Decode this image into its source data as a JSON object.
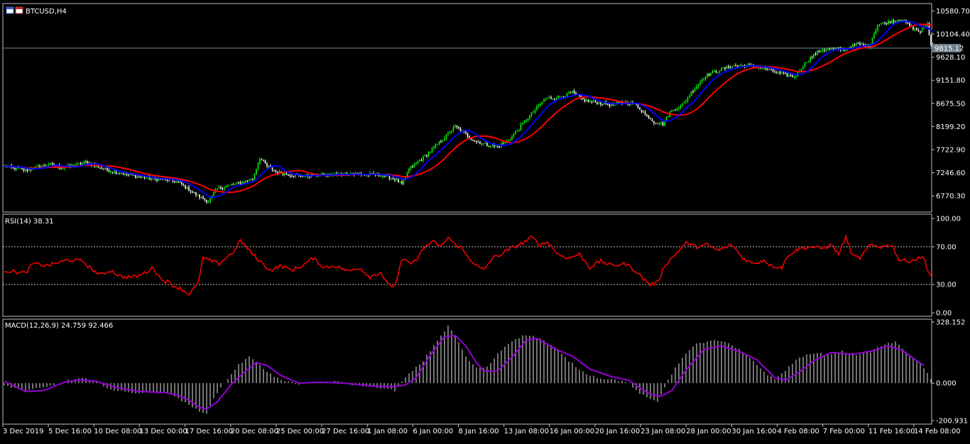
{
  "window": {
    "symbol_label": "BTCUSD,H4",
    "icon": "window-icon"
  },
  "colors": {
    "background": "#000000",
    "frame": "#c0c0c0",
    "grid": "#c0c0c0",
    "bull_candle": "#00ff00",
    "bear_candle": "#ffffff",
    "ma_fast": "#0000ff",
    "ma_slow": "#ff0000",
    "rsi": "#ff0000",
    "macd_hist": "#c0c0c0",
    "macd_signal": "#9400d3",
    "price_line": "#778899",
    "price_tag": "#708090"
  },
  "chart_data": [
    {
      "type": "candlestick",
      "panel": "price",
      "title": "BTCUSD,H4",
      "ylim": [
        6450,
        10720
      ],
      "yticks": [
        "10580.70",
        "10104.40",
        "9628.10",
        "9151.80",
        "8675.50",
        "8199.20",
        "7722.90",
        "7246.60",
        "6770.30"
      ],
      "current_price": "9815.12",
      "bar_count": 400,
      "x_tick_labels": [
        "3 Dec 2019",
        "5 Dec 16:00",
        "10 Dec 08:00",
        "13 Dec 00:00",
        "17 Dec 16:00",
        "20 Dec 08:00",
        "25 Dec 00:00",
        "27 Dec 16:00",
        "1 Jan 08:00",
        "6 Jan 00:00",
        "8 Jan 16:00",
        "13 Jan 08:00",
        "16 Jan 00:00",
        "20 Jan 16:00",
        "23 Jan 08:00",
        "28 Jan 00:00",
        "30 Jan 16:00",
        "4 Feb 08:00",
        "7 Feb 00:00",
        "11 Feb 16:00",
        "14 Feb 08:00"
      ],
      "close_path": [
        [
          0,
          7380
        ],
        [
          12,
          7300
        ],
        [
          25,
          7420
        ],
        [
          33,
          7350
        ],
        [
          38,
          7380
        ],
        [
          46,
          7460
        ],
        [
          58,
          7300
        ],
        [
          68,
          7220
        ],
        [
          76,
          7160
        ],
        [
          84,
          7120
        ],
        [
          92,
          7100
        ],
        [
          98,
          7050
        ],
        [
          104,
          6900
        ],
        [
          110,
          6750
        ],
        [
          115,
          6650
        ],
        [
          120,
          6920
        ],
        [
          131,
          7020
        ],
        [
          140,
          7120
        ],
        [
          144,
          7550
        ],
        [
          148,
          7380
        ],
        [
          154,
          7250
        ],
        [
          166,
          7180
        ],
        [
          180,
          7200
        ],
        [
          195,
          7220
        ],
        [
          212,
          7200
        ],
        [
          220,
          7120
        ],
        [
          224,
          7000
        ],
        [
          228,
          7320
        ],
        [
          238,
          7620
        ],
        [
          246,
          7900
        ],
        [
          254,
          8200
        ],
        [
          260,
          8050
        ],
        [
          265,
          7900
        ],
        [
          272,
          7820
        ],
        [
          278,
          7780
        ],
        [
          285,
          7950
        ],
        [
          292,
          8250
        ],
        [
          298,
          8500
        ],
        [
          305,
          8780
        ],
        [
          312,
          8800
        ],
        [
          320,
          8900
        ],
        [
          326,
          8750
        ],
        [
          332,
          8700
        ],
        [
          342,
          8650
        ],
        [
          350,
          8700
        ],
        [
          356,
          8650
        ],
        [
          361,
          8450
        ],
        [
          366,
          8300
        ],
        [
          371,
          8250
        ],
        [
          375,
          8500
        ],
        [
          382,
          8650
        ],
        [
          388,
          8950
        ],
        [
          395,
          9250
        ],
        [
          402,
          9350
        ],
        [
          410,
          9450
        ],
        [
          420,
          9450
        ],
        [
          428,
          9400
        ],
        [
          438,
          9280
        ],
        [
          445,
          9220
        ],
        [
          452,
          9550
        ],
        [
          460,
          9780
        ],
        [
          468,
          9800
        ],
        [
          473,
          9780
        ],
        [
          480,
          9900
        ],
        [
          487,
          9850
        ],
        [
          492,
          10300
        ],
        [
          498,
          10350
        ],
        [
          505,
          10420
        ],
        [
          511,
          10250
        ],
        [
          516,
          10150
        ],
        [
          520,
          10320
        ],
        [
          522,
          9880
        ],
        [
          523,
          9815
        ]
      ]
    },
    {
      "type": "line",
      "panel": "rsi",
      "label": "RSI(14) 38.31",
      "ylim": [
        0,
        100
      ],
      "yticks": [
        "100.00",
        "70.00",
        "30.00",
        "0.00"
      ],
      "levels": [
        70,
        30
      ],
      "values": [
        [
          0,
          45
        ],
        [
          12,
          42
        ],
        [
          16,
          52
        ],
        [
          24,
          50
        ],
        [
          36,
          56
        ],
        [
          44,
          55
        ],
        [
          48,
          48
        ],
        [
          54,
          40
        ],
        [
          60,
          45
        ],
        [
          66,
          38
        ],
        [
          74,
          38
        ],
        [
          80,
          43
        ],
        [
          84,
          48
        ],
        [
          88,
          36
        ],
        [
          92,
          33
        ],
        [
          96,
          28
        ],
        [
          100,
          25
        ],
        [
          104,
          20
        ],
        [
          109,
          30
        ],
        [
          112,
          58
        ],
        [
          121,
          52
        ],
        [
          126,
          60
        ],
        [
          130,
          66
        ],
        [
          133,
          77
        ],
        [
          137,
          68
        ],
        [
          142,
          58
        ],
        [
          150,
          45
        ],
        [
          156,
          50
        ],
        [
          162,
          45
        ],
        [
          168,
          50
        ],
        [
          174,
          58
        ],
        [
          180,
          48
        ],
        [
          186,
          50
        ],
        [
          194,
          44
        ],
        [
          200,
          48
        ],
        [
          206,
          38
        ],
        [
          212,
          43
        ],
        [
          216,
          30
        ],
        [
          220,
          28
        ],
        [
          224,
          56
        ],
        [
          230,
          52
        ],
        [
          238,
          72
        ],
        [
          242,
          75
        ],
        [
          246,
          70
        ],
        [
          250,
          80
        ],
        [
          254,
          72
        ],
        [
          257,
          70
        ],
        [
          260,
          62
        ],
        [
          266,
          50
        ],
        [
          270,
          45
        ],
        [
          275,
          58
        ],
        [
          280,
          62
        ],
        [
          285,
          68
        ],
        [
          292,
          74
        ],
        [
          297,
          80
        ],
        [
          302,
          72
        ],
        [
          306,
          75
        ],
        [
          312,
          62
        ],
        [
          318,
          58
        ],
        [
          324,
          62
        ],
        [
          330,
          48
        ],
        [
          336,
          55
        ],
        [
          342,
          50
        ],
        [
          350,
          52
        ],
        [
          356,
          44
        ],
        [
          360,
          36
        ],
        [
          364,
          30
        ],
        [
          368,
          32
        ],
        [
          372,
          50
        ],
        [
          378,
          62
        ],
        [
          384,
          74
        ],
        [
          390,
          70
        ],
        [
          396,
          72
        ],
        [
          402,
          66
        ],
        [
          410,
          72
        ],
        [
          416,
          58
        ],
        [
          422,
          52
        ],
        [
          428,
          56
        ],
        [
          432,
          50
        ],
        [
          438,
          48
        ],
        [
          442,
          62
        ],
        [
          448,
          68
        ],
        [
          454,
          70
        ],
        [
          460,
          68
        ],
        [
          466,
          72
        ],
        [
          470,
          62
        ],
        [
          474,
          80
        ],
        [
          478,
          60
        ],
        [
          482,
          58
        ],
        [
          488,
          72
        ],
        [
          494,
          70
        ],
        [
          500,
          72
        ],
        [
          504,
          56
        ],
        [
          510,
          55
        ],
        [
          516,
          58
        ],
        [
          518,
          60
        ],
        [
          520,
          45
        ],
        [
          522,
          38.31
        ]
      ]
    },
    {
      "type": "bar+line",
      "panel": "macd",
      "label": "MACD(12,26,9) 24.759 92.466",
      "ylim": [
        -200.931,
        328.152
      ],
      "yticks": [
        "328.152",
        "0.000",
        "-200.931"
      ],
      "histogram": [
        [
          0,
          -12
        ],
        [
          12,
          -40
        ],
        [
          24,
          -22
        ],
        [
          36,
          15
        ],
        [
          44,
          28
        ],
        [
          52,
          5
        ],
        [
          62,
          -40
        ],
        [
          74,
          -52
        ],
        [
          84,
          -48
        ],
        [
          92,
          -50
        ],
        [
          98,
          -80
        ],
        [
          104,
          -120
        ],
        [
          110,
          -150
        ],
        [
          114,
          -160
        ],
        [
          120,
          -50
        ],
        [
          126,
          25
        ],
        [
          132,
          100
        ],
        [
          138,
          140
        ],
        [
          142,
          120
        ],
        [
          148,
          60
        ],
        [
          156,
          15
        ],
        [
          166,
          -5
        ],
        [
          176,
          5
        ],
        [
          186,
          10
        ],
        [
          196,
          -8
        ],
        [
          206,
          -15
        ],
        [
          214,
          -30
        ],
        [
          220,
          -40
        ],
        [
          226,
          30
        ],
        [
          236,
          120
        ],
        [
          244,
          230
        ],
        [
          250,
          305
        ],
        [
          254,
          260
        ],
        [
          260,
          140
        ],
        [
          266,
          80
        ],
        [
          272,
          85
        ],
        [
          278,
          160
        ],
        [
          286,
          230
        ],
        [
          294,
          260
        ],
        [
          302,
          240
        ],
        [
          310,
          190
        ],
        [
          318,
          120
        ],
        [
          326,
          60
        ],
        [
          334,
          30
        ],
        [
          342,
          20
        ],
        [
          350,
          10
        ],
        [
          356,
          -40
        ],
        [
          362,
          -80
        ],
        [
          368,
          -100
        ],
        [
          374,
          20
        ],
        [
          382,
          140
        ],
        [
          390,
          210
        ],
        [
          398,
          230
        ],
        [
          406,
          220
        ],
        [
          414,
          180
        ],
        [
          422,
          120
        ],
        [
          428,
          60
        ],
        [
          434,
          20
        ],
        [
          440,
          70
        ],
        [
          448,
          140
        ],
        [
          456,
          160
        ],
        [
          464,
          155
        ],
        [
          472,
          170
        ],
        [
          480,
          155
        ],
        [
          488,
          170
        ],
        [
          496,
          210
        ],
        [
          502,
          220
        ],
        [
          508,
          170
        ],
        [
          514,
          120
        ],
        [
          518,
          80
        ],
        [
          522,
          25
        ]
      ],
      "signal": [
        [
          0,
          10
        ],
        [
          12,
          -45
        ],
        [
          22,
          -40
        ],
        [
          34,
          5
        ],
        [
          42,
          18
        ],
        [
          52,
          10
        ],
        [
          62,
          -20
        ],
        [
          76,
          -45
        ],
        [
          90,
          -50
        ],
        [
          98,
          -65
        ],
        [
          104,
          -90
        ],
        [
          110,
          -130
        ],
        [
          114,
          -140
        ],
        [
          120,
          -100
        ],
        [
          128,
          -5
        ],
        [
          136,
          65
        ],
        [
          142,
          110
        ],
        [
          148,
          95
        ],
        [
          156,
          40
        ],
        [
          166,
          0
        ],
        [
          178,
          5
        ],
        [
          192,
          0
        ],
        [
          206,
          -15
        ],
        [
          218,
          -20
        ],
        [
          226,
          -10
        ],
        [
          232,
          30
        ],
        [
          240,
          150
        ],
        [
          248,
          250
        ],
        [
          254,
          255
        ],
        [
          260,
          200
        ],
        [
          266,
          110
        ],
        [
          270,
          65
        ],
        [
          278,
          65
        ],
        [
          286,
          140
        ],
        [
          294,
          230
        ],
        [
          300,
          240
        ],
        [
          310,
          185
        ],
        [
          320,
          145
        ],
        [
          330,
          75
        ],
        [
          342,
          35
        ],
        [
          352,
          15
        ],
        [
          358,
          -25
        ],
        [
          364,
          -60
        ],
        [
          370,
          -70
        ],
        [
          376,
          -40
        ],
        [
          384,
          70
        ],
        [
          394,
          180
        ],
        [
          404,
          200
        ],
        [
          414,
          170
        ],
        [
          424,
          125
        ],
        [
          434,
          30
        ],
        [
          440,
          15
        ],
        [
          448,
          60
        ],
        [
          456,
          120
        ],
        [
          466,
          165
        ],
        [
          478,
          155
        ],
        [
          490,
          175
        ],
        [
          498,
          200
        ],
        [
          506,
          175
        ],
        [
          514,
          120
        ],
        [
          518,
          95
        ]
      ]
    }
  ]
}
